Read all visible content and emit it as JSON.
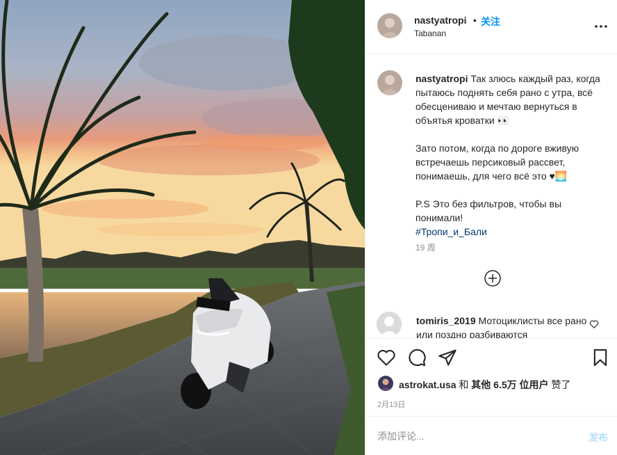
{
  "post": {
    "username": "nastyatropi",
    "separator": "•",
    "follow_label": "关注",
    "location": "Tabanan",
    "more_icon": "more-horizontal-icon"
  },
  "caption": {
    "username": "nastyatropi",
    "text": "Так злюсь каждый раз, когда пытаюсь поднять себя рано с утра, всё обесцениваю и мечтаю вернуться в объятья кроватки 👀\n\nЗато потом, когда по дороге вживую встречаешь персиковый рассвет, понимаешь, для чего всё это ♥🌅\n\nP.S Это без фильтров, чтобы вы понимали!",
    "hashtag": "#Тропи_и_Бали",
    "time_ago": "19 周"
  },
  "comments": [
    {
      "username": "tomiris_2019",
      "text": "Мотоциклисты все рано или поздно разбиваются"
    }
  ],
  "actions": {
    "like_icon": "heart-icon",
    "comment_icon": "comment-icon",
    "share_icon": "paper-plane-icon",
    "save_icon": "bookmark-icon"
  },
  "likes": {
    "user": "astrokat.usa",
    "and": "和",
    "others": "其他 6.5万 位用户",
    "liked": "赞了"
  },
  "date": "2月13日",
  "add_comment": {
    "placeholder": "添加评论...",
    "post_label": "发布"
  },
  "colors": {
    "accent": "#0095f6",
    "hashtag": "#00376b",
    "muted": "#8e8e8e",
    "post_disabled": "#b2dffc"
  }
}
